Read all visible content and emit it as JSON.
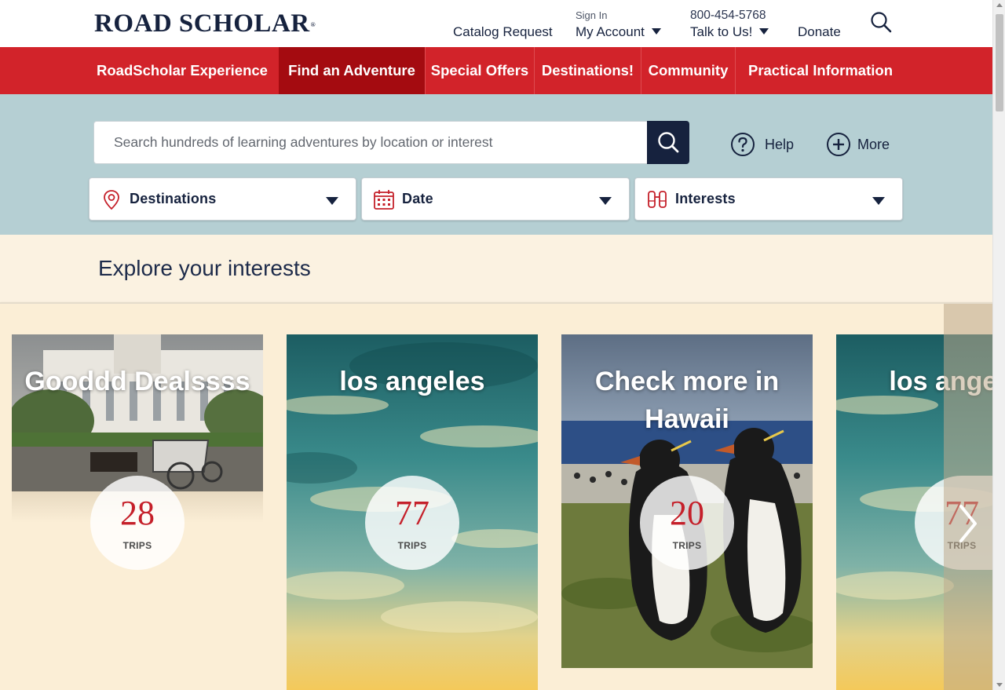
{
  "header": {
    "logo_text": "ROAD SCHOLAR",
    "logo_mark": "®",
    "catalog_request": "Catalog Request",
    "sign_in": "Sign In",
    "my_account": "My Account",
    "phone": "800-454-5768",
    "talk_to_us": "Talk to Us!",
    "donate": "Donate",
    "search_icon": "search-icon"
  },
  "nav": {
    "items": [
      {
        "label": "RoadScholar Experience"
      },
      {
        "label": "Find an Adventure",
        "active": true
      },
      {
        "label": "Special Offers"
      },
      {
        "label": "Destinations!"
      },
      {
        "label": "Community"
      },
      {
        "label": "Practical Information"
      }
    ]
  },
  "search": {
    "placeholder": "Search hundreds of learning adventures by location or interest",
    "value": "",
    "help_label": "Help",
    "more_label": "More"
  },
  "filters": [
    {
      "label": "Destinations",
      "icon": "map-pin-icon"
    },
    {
      "label": "Date",
      "icon": "calendar-icon"
    },
    {
      "label": "Interests",
      "icon": "binoculars-icon"
    }
  ],
  "explore": {
    "title": "Explore your interests",
    "cards": [
      {
        "title": "Gooddd Dealssss",
        "count": "28",
        "count_label": "TRIPS"
      },
      {
        "title": "los angeles",
        "count": "77",
        "count_label": "TRIPS"
      },
      {
        "title": "Check more in Hawaii",
        "count": "20",
        "count_label": "TRIPS"
      },
      {
        "title": "los angeles",
        "count": "77",
        "count_label": "TRIPS"
      }
    ]
  },
  "colors": {
    "brand_red": "#d2232a",
    "nav_active": "#a40b10",
    "navy": "#16223e",
    "band": "#b5cfd3",
    "cream": "#fbf2e1",
    "badge_number": "#c5202a"
  }
}
